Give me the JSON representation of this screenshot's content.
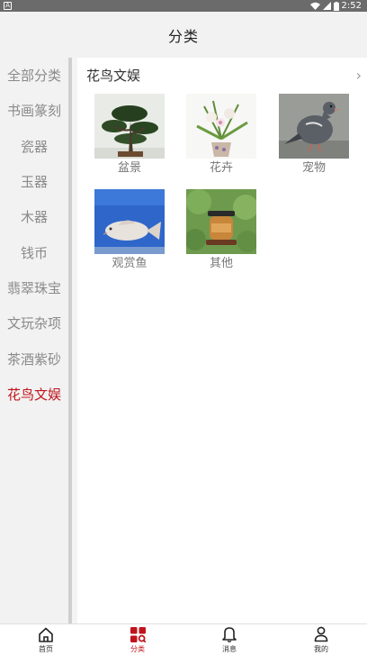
{
  "status_bar": {
    "app_badge": "A",
    "time": "2:52"
  },
  "header": {
    "title": "分类"
  },
  "sidebar": {
    "items": [
      {
        "label": "全部分类"
      },
      {
        "label": "书画篆刻"
      },
      {
        "label": "瓷器"
      },
      {
        "label": "玉器"
      },
      {
        "label": "木器"
      },
      {
        "label": "钱币"
      },
      {
        "label": "翡翠珠宝"
      },
      {
        "label": "文玩杂项"
      },
      {
        "label": "茶酒紫砂"
      },
      {
        "label": "花鸟文娱"
      }
    ],
    "active_index": 9
  },
  "content": {
    "category_title": "花鸟文娱",
    "chevron": "›",
    "tiles": [
      {
        "label": "盆景",
        "icon": "bonsai"
      },
      {
        "label": "花卉",
        "icon": "flower-pot"
      },
      {
        "label": "宠物",
        "icon": "pigeon"
      },
      {
        "label": "观赏鱼",
        "icon": "koi-fish"
      },
      {
        "label": "其他",
        "icon": "cricket-jar"
      }
    ]
  },
  "tabbar": {
    "items": [
      {
        "label": "首页",
        "icon": "home-icon"
      },
      {
        "label": "分类",
        "icon": "category-icon"
      },
      {
        "label": "消息",
        "icon": "bell-icon"
      },
      {
        "label": "我的",
        "icon": "user-icon"
      }
    ],
    "active_index": 1
  },
  "colors": {
    "accent": "#c0141c",
    "sidebar_bg": "#f2f2f2",
    "statusbar_bg": "#6b6b6b"
  }
}
